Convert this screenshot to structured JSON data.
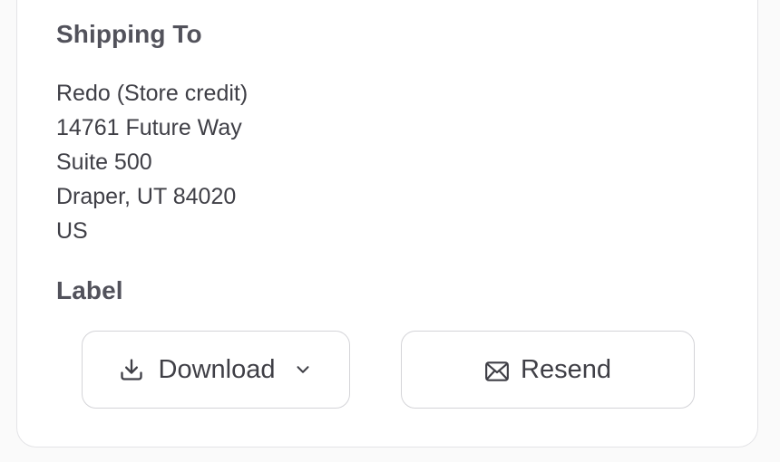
{
  "shipping": {
    "title": "Shipping To",
    "address_lines": [
      "Redo (Store credit)",
      "14761 Future Way",
      "Suite 500",
      "Draper, UT 84020",
      "US"
    ]
  },
  "label": {
    "title": "Label",
    "download_button": {
      "label": "Download",
      "icon": "download-icon",
      "trailing_icon": "chevron-down-icon"
    },
    "resend_button": {
      "label": "Resend",
      "icon": "mail-icon"
    }
  },
  "colors": {
    "background": "#fafafa",
    "card": "#ffffff",
    "border": "#d4d4d8",
    "text": "#3f3f46",
    "heading": "#52525b"
  }
}
